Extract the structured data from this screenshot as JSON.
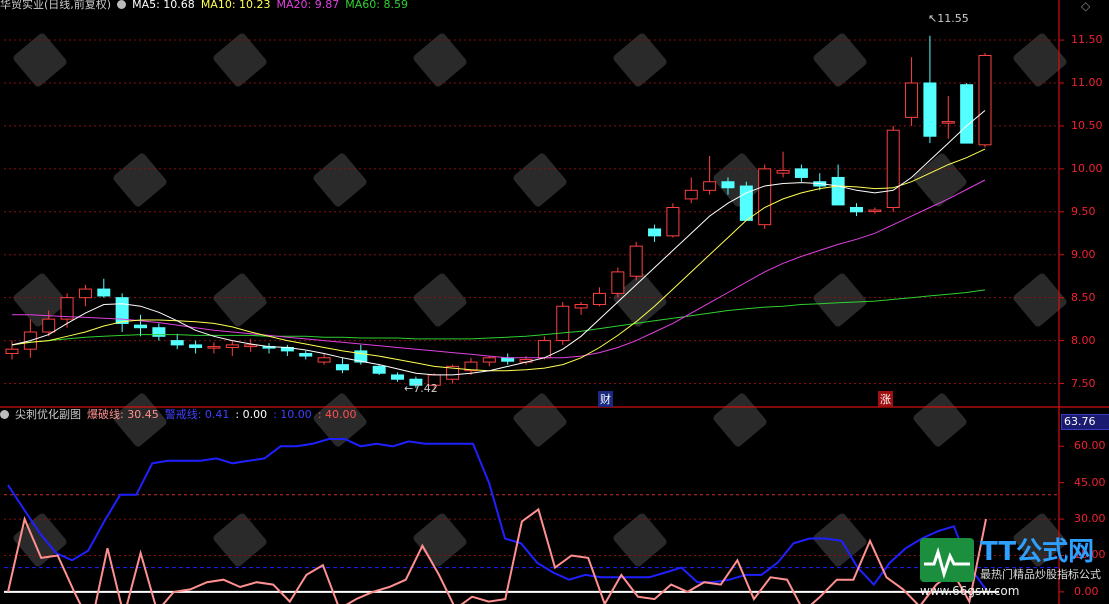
{
  "top_header": {
    "stock": "华贸实业(日线,前复权)",
    "ma5": "MA5: 10.68",
    "ma10": "MA10: 10.23",
    "ma20": "MA20: 9.87",
    "ma60": "MA60: 8.59"
  },
  "sub_header": {
    "title": "尖刺优化副图",
    "l1": "爆破线: 30.45",
    "l2": "警戒线: 0.41",
    "l3": ": 0.00",
    "l4": ": 10.00",
    "l5": ": 40.00"
  },
  "markers": {
    "cai": "财",
    "zhang": "涨",
    "high": "11.55",
    "low": "7.42"
  },
  "sub_current_value": "63.76",
  "watermark": {
    "brand": "TT公式网",
    "slogan": "最热门精品炒股指标公式",
    "url": "www.66gsw.com"
  },
  "colors": {
    "up": "#ff4040",
    "down": "#54ffff",
    "ma5": "#ffffff",
    "ma10": "#ffff50",
    "ma20": "#e040e0",
    "ma60": "#30d030",
    "blue": "#2020ff",
    "pink": "#ff9090"
  },
  "chart_data": [
    {
      "type": "candlestick",
      "yticks": [
        7.5,
        8.0,
        8.5,
        9.0,
        9.5,
        10.0,
        10.5,
        11.0,
        11.5
      ],
      "ylim": [
        7.25,
        11.85
      ],
      "candles": [
        [
          7.85,
          8.0,
          7.78,
          7.9
        ],
        [
          7.9,
          8.25,
          7.8,
          8.1
        ],
        [
          8.1,
          8.35,
          8.05,
          8.25
        ],
        [
          8.25,
          8.55,
          8.15,
          8.5
        ],
        [
          8.5,
          8.65,
          8.4,
          8.6
        ],
        [
          8.6,
          8.72,
          8.5,
          8.52
        ],
        [
          8.5,
          8.55,
          8.1,
          8.2
        ],
        [
          8.18,
          8.3,
          8.05,
          8.15
        ],
        [
          8.15,
          8.2,
          8.0,
          8.05
        ],
        [
          8.0,
          8.08,
          7.9,
          7.95
        ],
        [
          7.95,
          8.0,
          7.85,
          7.92
        ],
        [
          7.93,
          7.98,
          7.85,
          7.93
        ],
        [
          7.92,
          8.0,
          7.82,
          7.95
        ],
        [
          7.93,
          8.02,
          7.87,
          7.95
        ],
        [
          7.93,
          7.97,
          7.85,
          7.92
        ],
        [
          7.92,
          7.95,
          7.82,
          7.88
        ],
        [
          7.85,
          7.88,
          7.78,
          7.82
        ],
        [
          7.75,
          7.85,
          7.72,
          7.8
        ],
        [
          7.72,
          7.8,
          7.62,
          7.66
        ],
        [
          7.88,
          7.95,
          7.72,
          7.75
        ],
        [
          7.7,
          7.72,
          7.6,
          7.62
        ],
        [
          7.6,
          7.63,
          7.52,
          7.55
        ],
        [
          7.55,
          7.58,
          7.45,
          7.48
        ],
        [
          7.48,
          7.62,
          7.42,
          7.6
        ],
        [
          7.55,
          7.72,
          7.5,
          7.7
        ],
        [
          7.65,
          7.8,
          7.6,
          7.75
        ],
        [
          7.75,
          7.82,
          7.7,
          7.8
        ],
        [
          7.8,
          7.85,
          7.72,
          7.76
        ],
        [
          7.75,
          7.82,
          7.72,
          7.78
        ],
        [
          7.8,
          8.05,
          7.78,
          8.0
        ],
        [
          8.0,
          8.45,
          7.95,
          8.4
        ],
        [
          8.38,
          8.45,
          8.3,
          8.42
        ],
        [
          8.42,
          8.62,
          8.4,
          8.55
        ],
        [
          8.55,
          8.85,
          8.5,
          8.8
        ],
        [
          8.75,
          9.15,
          8.7,
          9.1
        ],
        [
          9.3,
          9.35,
          9.15,
          9.22
        ],
        [
          9.22,
          9.6,
          9.2,
          9.55
        ],
        [
          9.65,
          9.9,
          9.6,
          9.75
        ],
        [
          9.75,
          10.15,
          9.7,
          9.85
        ],
        [
          9.85,
          9.9,
          9.7,
          9.78
        ],
        [
          9.8,
          9.85,
          9.4,
          9.4
        ],
        [
          9.35,
          10.05,
          9.3,
          10.0
        ],
        [
          9.95,
          10.2,
          9.9,
          9.98
        ],
        [
          10.0,
          10.05,
          9.85,
          9.9
        ],
        [
          9.85,
          9.95,
          9.75,
          9.8
        ],
        [
          9.9,
          10.05,
          9.6,
          9.58
        ],
        [
          9.55,
          9.6,
          9.45,
          9.5
        ],
        [
          9.52,
          9.55,
          9.48,
          9.52
        ],
        [
          9.55,
          10.5,
          9.5,
          10.45
        ],
        [
          10.6,
          11.3,
          10.5,
          11.0
        ],
        [
          11.0,
          11.55,
          10.3,
          10.38
        ],
        [
          10.55,
          10.85,
          10.35,
          10.55
        ],
        [
          10.98,
          11.0,
          10.3,
          10.3
        ],
        [
          10.28,
          11.35,
          10.25,
          11.32
        ]
      ],
      "ma5": [
        7.95,
        8.0,
        8.07,
        8.2,
        8.32,
        8.42,
        8.43,
        8.4,
        8.33,
        8.23,
        8.12,
        8.05,
        8.0,
        7.96,
        7.93,
        7.92,
        7.89,
        7.85,
        7.8,
        7.76,
        7.72,
        7.67,
        7.62,
        7.6,
        7.6,
        7.62,
        7.65,
        7.7,
        7.75,
        7.8,
        7.9,
        8.05,
        8.25,
        8.45,
        8.65,
        8.85,
        9.05,
        9.25,
        9.45,
        9.6,
        9.72,
        9.8,
        9.83,
        9.84,
        9.83,
        9.8,
        9.75,
        9.72,
        9.75,
        9.9,
        10.1,
        10.3,
        10.5,
        10.68
      ],
      "ma10": [
        7.95,
        7.98,
        8.0,
        8.05,
        8.1,
        8.17,
        8.22,
        8.24,
        8.24,
        8.23,
        8.22,
        8.2,
        8.16,
        8.1,
        8.05,
        8.0,
        7.96,
        7.92,
        7.88,
        7.85,
        7.82,
        7.78,
        7.74,
        7.7,
        7.68,
        7.66,
        7.65,
        7.65,
        7.66,
        7.68,
        7.72,
        7.8,
        7.92,
        8.06,
        8.22,
        8.4,
        8.6,
        8.8,
        9.0,
        9.2,
        9.4,
        9.55,
        9.65,
        9.72,
        9.77,
        9.8,
        9.79,
        9.77,
        9.78,
        9.85,
        9.95,
        10.05,
        10.13,
        10.23
      ],
      "ma20": [
        8.3,
        8.3,
        8.29,
        8.28,
        8.27,
        8.26,
        8.25,
        8.23,
        8.21,
        8.18,
        8.15,
        8.12,
        8.1,
        8.08,
        8.06,
        8.04,
        8.02,
        8.0,
        7.98,
        7.96,
        7.94,
        7.92,
        7.9,
        7.88,
        7.86,
        7.84,
        7.82,
        7.8,
        7.8,
        7.8,
        7.8,
        7.82,
        7.86,
        7.92,
        8.0,
        8.1,
        8.2,
        8.32,
        8.44,
        8.56,
        8.68,
        8.8,
        8.9,
        8.98,
        9.05,
        9.12,
        9.18,
        9.25,
        9.35,
        9.45,
        9.55,
        9.65,
        9.76,
        9.87
      ],
      "ma60": [
        7.95,
        7.98,
        8.0,
        8.02,
        8.04,
        8.05,
        8.06,
        8.07,
        8.07,
        8.07,
        8.06,
        8.06,
        8.06,
        8.06,
        8.05,
        8.05,
        8.05,
        8.04,
        8.04,
        8.03,
        8.03,
        8.03,
        8.02,
        8.02,
        8.02,
        8.02,
        8.03,
        8.04,
        8.05,
        8.07,
        8.09,
        8.11,
        8.14,
        8.17,
        8.2,
        8.23,
        8.26,
        8.29,
        8.32,
        8.35,
        8.37,
        8.39,
        8.4,
        8.42,
        8.43,
        8.44,
        8.45,
        8.46,
        8.48,
        8.5,
        8.52,
        8.54,
        8.56,
        8.59
      ]
    },
    {
      "type": "line",
      "yticks": [
        0,
        15,
        30,
        45,
        60
      ],
      "ylim": [
        -5,
        70
      ],
      "levels": [
        0,
        10,
        40
      ],
      "series": [
        {
          "name": "警戒线",
          "values": [
            44,
            34,
            24,
            16,
            13,
            17,
            29,
            40,
            40,
            53,
            54,
            54,
            54,
            55,
            53,
            54,
            55,
            60,
            60,
            61,
            63,
            63,
            60,
            61,
            60,
            62,
            61,
            61,
            61,
            61,
            45,
            22,
            20,
            12,
            8,
            5,
            7,
            6,
            6,
            6,
            6,
            8,
            10,
            4,
            4,
            5,
            7,
            7,
            12,
            20,
            22,
            22,
            21,
            10,
            3,
            12,
            18,
            22,
            25,
            27,
            10,
            1
          ]
        },
        {
          "name": "爆破线",
          "values": [
            0,
            30,
            14,
            15,
            0,
            -14,
            18,
            -10,
            16,
            -8,
            0,
            1,
            4,
            5,
            2,
            4,
            3,
            -4,
            7,
            11,
            -7,
            -3,
            0,
            2,
            5,
            19,
            7,
            -7,
            -2,
            -4,
            -3,
            29,
            34,
            10,
            15,
            14,
            -5,
            7,
            -2,
            -3,
            3,
            0,
            4,
            3,
            13,
            -3,
            6,
            5,
            -8,
            -2,
            5,
            5,
            21,
            6,
            1,
            -6,
            3,
            8,
            -4,
            30
          ]
        }
      ]
    }
  ]
}
